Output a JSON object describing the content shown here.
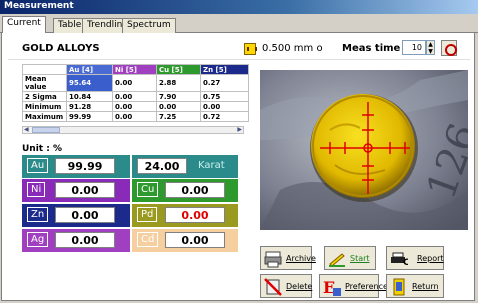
{
  "window": {
    "title": "Measurement"
  },
  "tabs": [
    {
      "label": "Current",
      "active": true
    },
    {
      "label": "Table",
      "active": false
    },
    {
      "label": "Trendline",
      "active": false
    },
    {
      "label": "Spectrum",
      "active": false
    }
  ],
  "header": {
    "alloy": "GOLD ALLOYS",
    "thickness": "0.500 mm o",
    "meas_time_label": "Meas time",
    "meas_time_value": "10"
  },
  "stats": {
    "columns": [
      {
        "label": "Au [4]",
        "color": "#4a6bd4"
      },
      {
        "label": "Ni [5]",
        "color": "#a040c0"
      },
      {
        "label": "Cu [5]",
        "color": "#2e9a2e"
      },
      {
        "label": "Zn [5]",
        "color": "#1c2a8c"
      }
    ],
    "rows": [
      {
        "label": "Mean value",
        "values": [
          "95.64",
          "0.00",
          "2.88",
          "0.27"
        ]
      },
      {
        "label": "2 Sigma",
        "values": [
          "10.84",
          "0.00",
          "7.90",
          "0.75"
        ]
      },
      {
        "label": "Minimum",
        "values": [
          "91.28",
          "0.00",
          "0.00",
          "0.00"
        ]
      },
      {
        "label": "Maximum",
        "values": [
          "99.99",
          "0.00",
          "7.25",
          "0.72"
        ]
      }
    ]
  },
  "unit_label": "Unit : %",
  "elements": {
    "au": {
      "symbol": "Au",
      "value": "99.99",
      "color": "#2b8a8a"
    },
    "karat": {
      "value": "24.00",
      "label": "Karat",
      "color": "#2b8a8a"
    },
    "ni": {
      "symbol": "Ni",
      "value": "0.00",
      "color": "#8a2ab8"
    },
    "cu": {
      "symbol": "Cu",
      "value": "0.00",
      "color": "#2e9a2e"
    },
    "zn": {
      "symbol": "Zn",
      "value": "0.00",
      "color": "#1c2a8c"
    },
    "pd": {
      "symbol": "Pd",
      "value": "0.00",
      "color": "#9a9a20",
      "value_color": "#e00000"
    },
    "ag": {
      "symbol": "Ag",
      "value": "0.00",
      "color": "#a040c0"
    },
    "cd": {
      "symbol": "Cd",
      "value": "0.00",
      "color": "#f5cfa0"
    }
  },
  "photo": {
    "engraving": "126"
  },
  "buttons": {
    "archive": "Archive",
    "start": "Start",
    "report": "Report",
    "delete": "Delete",
    "preference": "Preference",
    "return": "Return"
  },
  "icons": {
    "thickness": "thickness-gauge-icon",
    "measure": "measure-target-icon",
    "archive": "archive-printer-icon",
    "start": "start-icon",
    "report": "report-print-icon",
    "delete": "delete-icon",
    "preference": "preference-icon",
    "return": "return-icon"
  }
}
